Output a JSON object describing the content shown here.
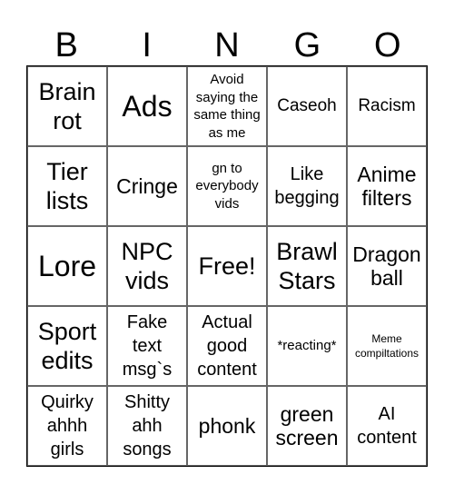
{
  "header": [
    "B",
    "I",
    "N",
    "G",
    "O"
  ],
  "cells": [
    [
      "Brain rot",
      "Ads",
      "Avoid saying the same thing as me",
      "Caseoh",
      "Racism"
    ],
    [
      "Tier lists",
      "Cringe",
      "gn to everybody vids",
      "Like begging",
      "Anime filters"
    ],
    [
      "Lore",
      "NPC vids",
      "Free!",
      "Brawl Stars",
      "Dragon ball"
    ],
    [
      "Sport edits",
      "Fake text msg`s",
      "Actual good content",
      "*reacting*",
      "Meme compiltations"
    ],
    [
      "Quirky ahhh girls",
      "Shitty ahh songs",
      "phonk",
      "green screen",
      "AI content"
    ]
  ]
}
